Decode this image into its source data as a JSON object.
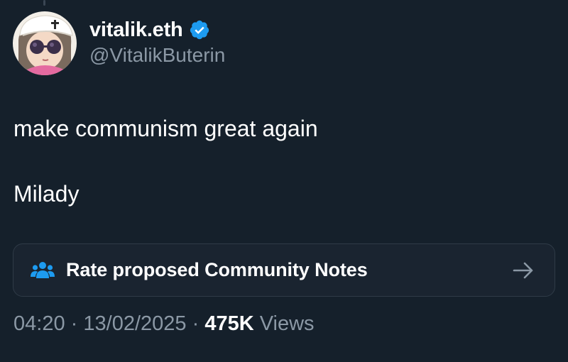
{
  "author": {
    "display_name": "vitalik.eth",
    "handle": "@VitalikButerin",
    "verified": true,
    "verified_color": "#1d9bf0",
    "avatar_icon": "milady-avatar"
  },
  "tweet": {
    "lines": [
      "make communism great again",
      "Milady"
    ]
  },
  "community_notes": {
    "label": "Rate proposed Community Notes",
    "icon": "people-icon",
    "icon_color": "#1d9bf0",
    "action_icon": "arrow-right-icon"
  },
  "meta": {
    "time": "04:20",
    "separator": "·",
    "date": "13/02/2025",
    "views_count": "475K",
    "views_label": "Views"
  },
  "colors": {
    "background": "#15202b",
    "text_primary": "#ffffff",
    "text_secondary": "#8b98a5"
  }
}
